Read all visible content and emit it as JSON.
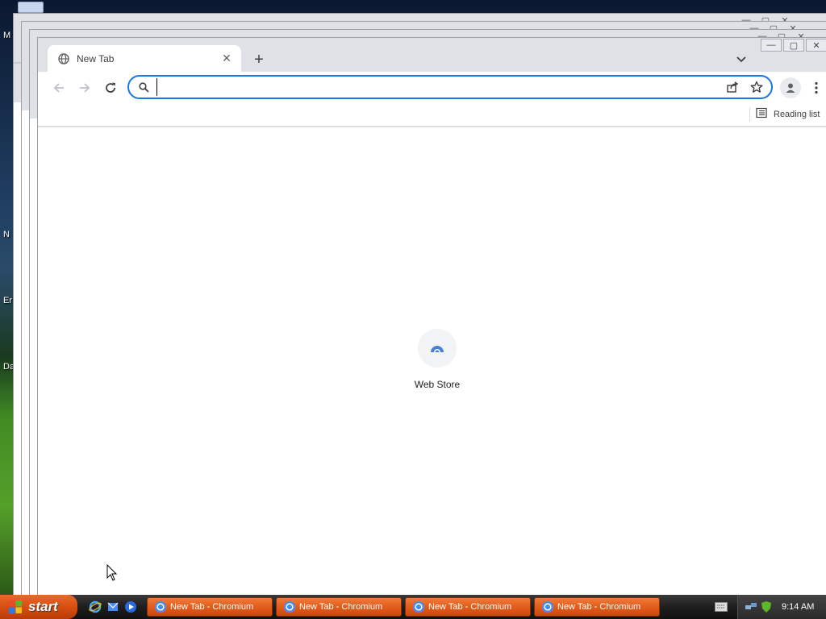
{
  "desktop": {
    "labels": [
      "M",
      "N",
      "Er",
      "Da"
    ]
  },
  "browser": {
    "tab": {
      "title": "New Tab",
      "close_glyph": "✕"
    },
    "new_tab_glyph": "+",
    "omnibox": {
      "value": "",
      "placeholder": ""
    },
    "bookmarks_bar": {
      "reading_list_label": "Reading list"
    },
    "shortcuts": [
      {
        "label": "Web Store",
        "icon": "webstore-icon"
      }
    ]
  },
  "taskbar": {
    "start_label": "start",
    "buttons": [
      {
        "label": "New Tab - Chromium"
      },
      {
        "label": "New Tab - Chromium"
      },
      {
        "label": "New Tab - Chromium"
      },
      {
        "label": "New Tab - Chromium"
      }
    ],
    "clock": "9:14 AM"
  },
  "colors": {
    "accent": "#1a73e8",
    "tabstrip_bg": "#dee1e6",
    "taskbar_button": "#e05a18"
  }
}
